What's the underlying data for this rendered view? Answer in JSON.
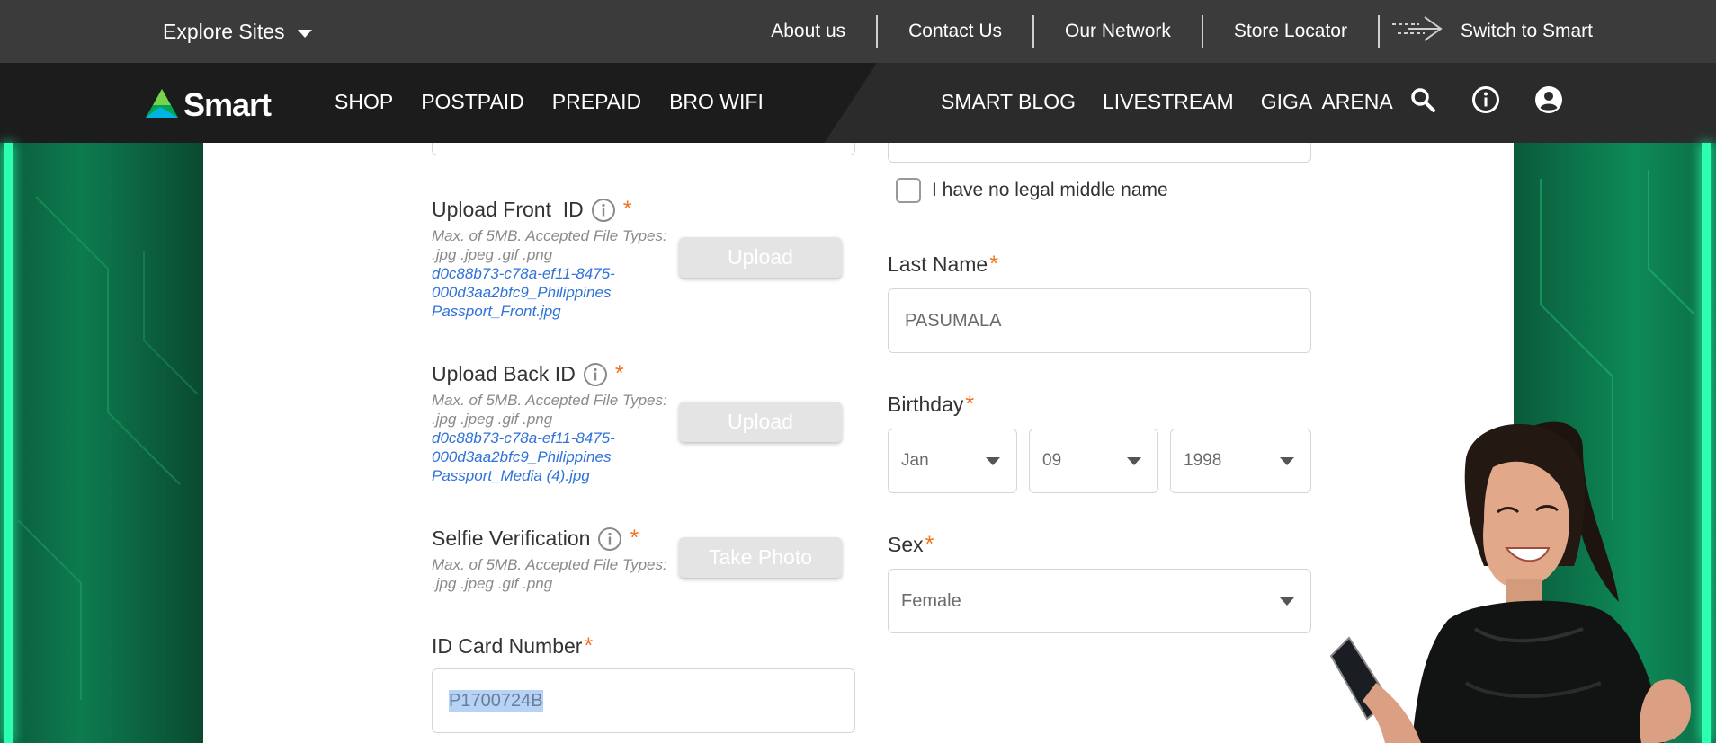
{
  "topbar": {
    "explore_label": "Explore Sites",
    "links": [
      "About us",
      "Contact Us",
      "Our Network",
      "Store Locator"
    ],
    "switch_label": "Switch to Smart"
  },
  "nav": {
    "logo_text": "Smart",
    "left_items": [
      "SHOP",
      "POSTPAID",
      "PREPAID",
      "BRO WIFI"
    ],
    "right_items": [
      "SMART BLOG",
      "LIVESTREAM",
      "GIGA  ARENA"
    ],
    "icons": [
      "search-icon",
      "info-icon",
      "account-icon"
    ]
  },
  "form": {
    "help_text": "Max. of 5MB. Accepted File Types: .jpg .jpeg .gif .png",
    "selfie_help_text": "Max. of 5MB. Accepted File Types: .jpg .jpeg .gif  .png",
    "front_id": {
      "label": "Upload Front  ID",
      "file_name": "d0c88b73-c78a-ef11-8475-000d3aa2bfc9_Philippines Passport_Front.jpg",
      "button": "Upload"
    },
    "back_id": {
      "label": "Upload Back ID",
      "file_name": "d0c88b73-c78a-ef11-8475-000d3aa2bfc9_Philippines Passport_Media (4).jpg",
      "button": "Upload"
    },
    "selfie": {
      "label": "Selfie Verification",
      "button": "Take Photo"
    },
    "id_card": {
      "label": "ID Card Number",
      "value": "P1700724B"
    },
    "no_middle_name": {
      "label": "I have no legal middle name",
      "checked": false
    },
    "last_name": {
      "label": "Last Name",
      "value": "PASUMALA"
    },
    "birthday": {
      "label": "Birthday",
      "month": "Jan",
      "day": "09",
      "year": "1998"
    },
    "sex": {
      "label": "Sex",
      "value": "Female"
    },
    "required_mark": "*"
  },
  "colors": {
    "accent_orange": "#f2711c",
    "link_blue": "#2f72d8",
    "brand_green": "#00a651"
  }
}
